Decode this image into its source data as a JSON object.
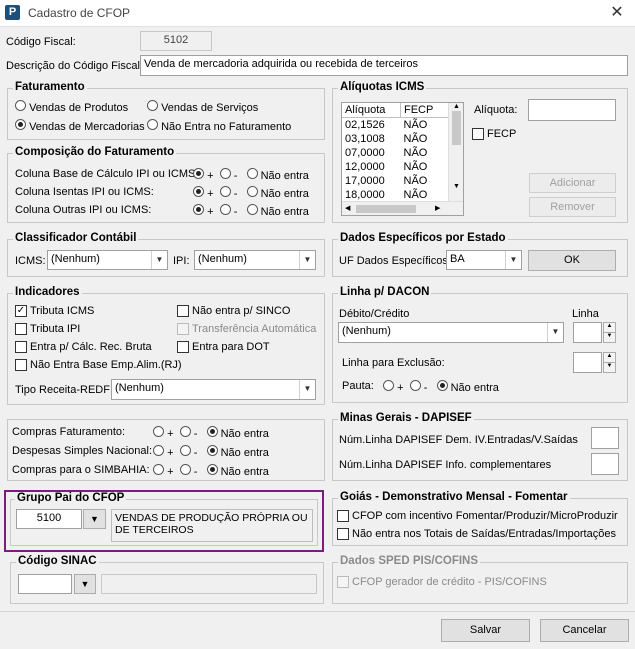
{
  "window": {
    "title": "Cadastro de CFOP",
    "app_icon": "P"
  },
  "codigo_fiscal": {
    "label": "Código Fiscal:",
    "value": "5102"
  },
  "descricao": {
    "label": "Descrição do Código Fiscal:",
    "value": "Venda de mercadoria adquirida ou recebida de terceiros"
  },
  "faturamento": {
    "title": "Faturamento",
    "options": [
      "Vendas de Produtos",
      "Vendas de Serviços",
      "Vendas de Mercadorias",
      "Não Entra no Faturamento"
    ],
    "selected": "Vendas de Mercadorias"
  },
  "composicao": {
    "title": "Composição do Faturamento",
    "rows": [
      {
        "label": "Coluna Base de Cálculo IPI ou ICMS:",
        "selected": "+"
      },
      {
        "label": "Coluna Isentas IPI ou ICMS:",
        "selected": "+"
      },
      {
        "label": "Coluna Outras IPI ou ICMS:",
        "selected": "+"
      }
    ],
    "opt_plus": "+",
    "opt_minus": "-",
    "opt_none": "Não entra"
  },
  "classificador": {
    "title": "Classificador Contábil",
    "icms_label": "ICMS:",
    "icms_value": "(Nenhum)",
    "ipi_label": "IPI:",
    "ipi_value": "(Nenhum)"
  },
  "indicadores": {
    "title": "Indicadores",
    "tributa_icms": "Tributa ICMS",
    "tributa_ipi": "Tributa IPI",
    "entra_calc": "Entra p/ Cálc. Rec. Bruta",
    "nao_entra_base": "Não Entra Base Emp.Alim.(RJ)",
    "nao_entra_sinco": "Não entra p/ SINCO",
    "transferencia": "Transferência Automática",
    "entra_dot": "Entra para DOT",
    "tipo_receita_label": "Tipo Receita-REDF:",
    "tipo_receita_value": "(Nenhum)"
  },
  "compras": {
    "rows": [
      {
        "label": "Compras Faturamento:",
        "selected": "Não entra"
      },
      {
        "label": "Despesas Simples Nacional:",
        "selected": "Não entra"
      },
      {
        "label": "Compras para o SIMBAHIA:",
        "selected": "Não entra"
      }
    ],
    "opt_plus": "+",
    "opt_minus": "-",
    "opt_none": "Não entra"
  },
  "grupo_pai": {
    "title": "Grupo Pai do CFOP",
    "code": "5100",
    "description": "VENDAS DE PRODUÇÃO PRÓPRIA OU DE TERCEIROS"
  },
  "sinac": {
    "title": "Código SINAC",
    "code": "",
    "description": ""
  },
  "aliquotas": {
    "title": "Alíquotas ICMS",
    "columns": [
      "Alíquota",
      "FECP"
    ],
    "rows": [
      [
        "02,1526",
        "NÃO"
      ],
      [
        "03,1008",
        "NÃO"
      ],
      [
        "07,0000",
        "NÃO"
      ],
      [
        "12,0000",
        "NÃO"
      ],
      [
        "17,0000",
        "NÃO"
      ],
      [
        "18,0000",
        "NÃO"
      ]
    ],
    "aliquota_label": "Alíquota:",
    "fecp_label": "FECP",
    "adicionar": "Adicionar",
    "remover": "Remover"
  },
  "dados_estado": {
    "title": "Dados Específicos por Estado",
    "uf_label": "UF Dados Específicos:",
    "uf_value": "BA",
    "ok": "OK"
  },
  "dacon": {
    "title": "Linha p/ DACON",
    "debito_label": "Débito/Crédito",
    "debito_value": "(Nenhum)",
    "linha_label": "Linha",
    "exclusao_label": "Linha para Exclusão:",
    "pauta_label": "Pauta:",
    "opt_plus": "+",
    "opt_minus": "-",
    "opt_none": "Não entra",
    "pauta_selected": "Não entra"
  },
  "minas": {
    "title": "Minas Gerais - DAPISEF",
    "dem_label": "Núm.Linha DAPISEF Dem. IV.Entradas/V.Saídas",
    "info_label": "Núm.Linha DAPISEF Info. complementares"
  },
  "goias": {
    "title": "Goiás - Demonstrativo Mensal - Fomentar",
    "cfop_incentivo": "CFOP com incentivo  Fomentar/Produzir/MicroProduzir",
    "nao_entra_totais": "Não entra nos Totais de  Saídas/Entradas/Importações"
  },
  "sped": {
    "title": "Dados SPED PIS/COFINS",
    "cfop_gerador": "CFOP gerador de crédito - PIS/COFINS"
  },
  "footer": {
    "salvar": "Salvar",
    "cancelar": "Cancelar"
  },
  "colors": {
    "highlight_border": "#7b1c7e",
    "icon_bg": "#1f4e79"
  }
}
